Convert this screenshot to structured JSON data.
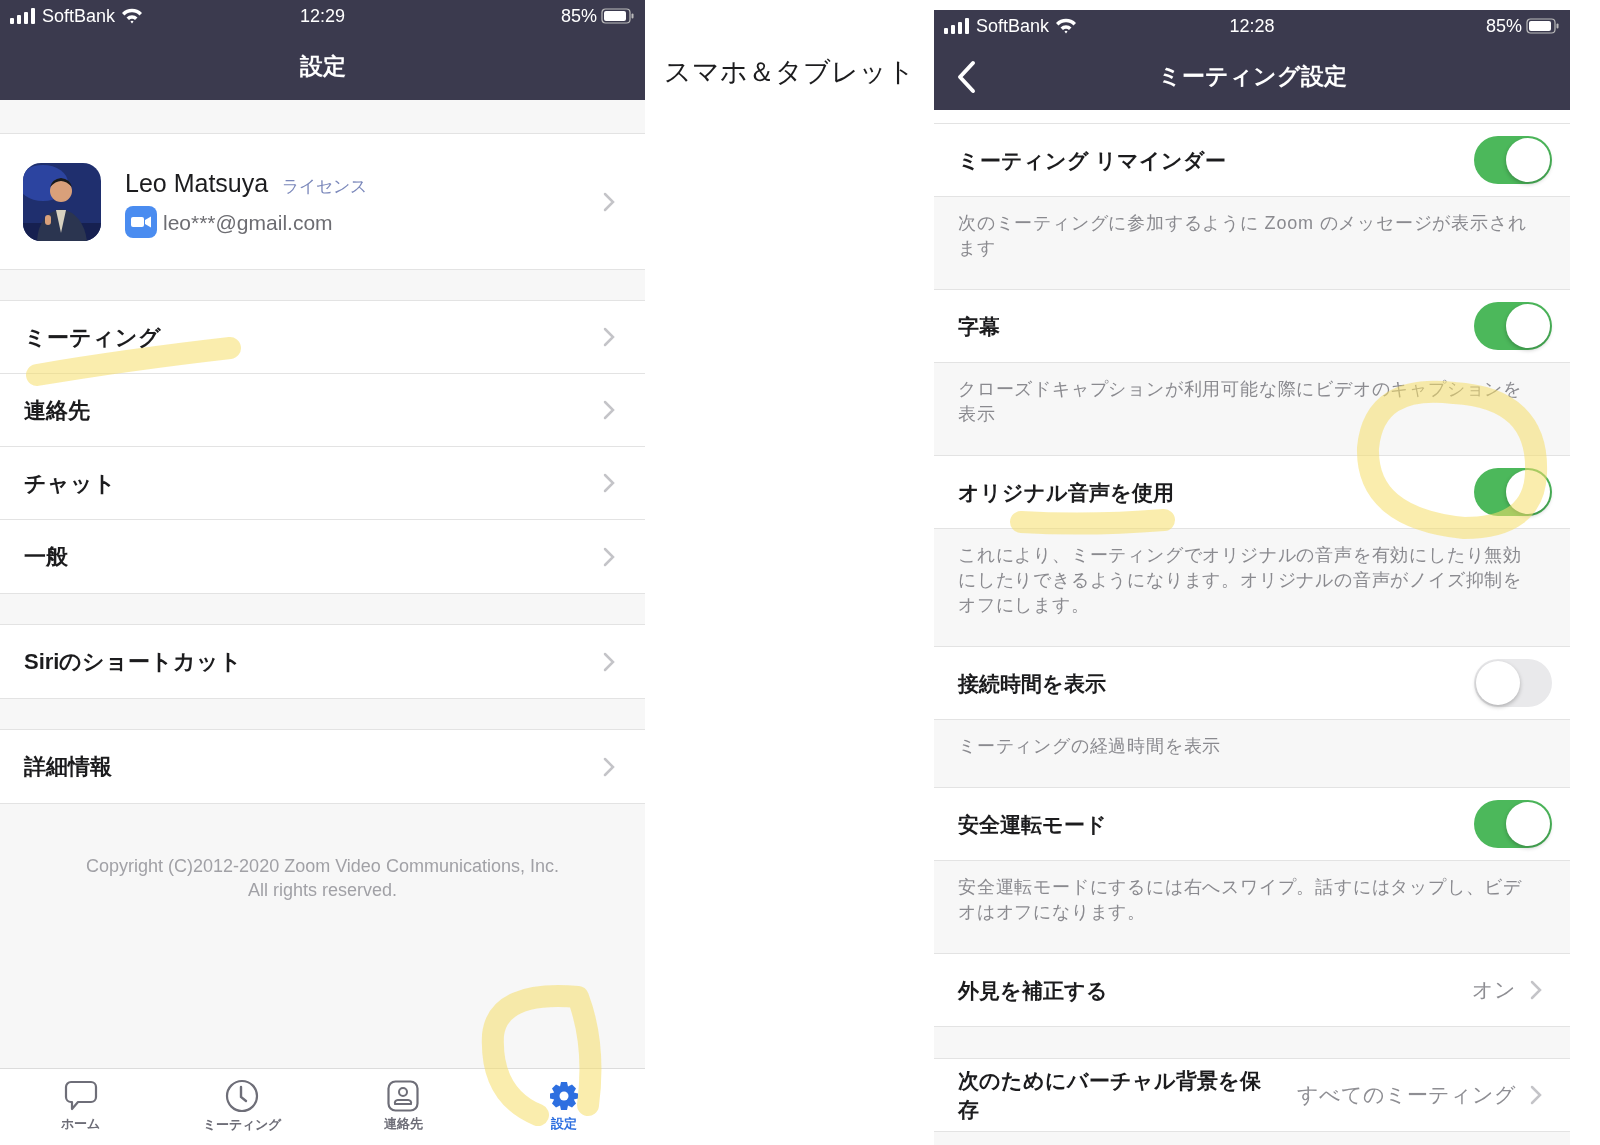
{
  "left_screen": {
    "status_bar": {
      "carrier": "SoftBank",
      "time": "12:29",
      "battery": "85%"
    },
    "title": "設定",
    "profile": {
      "name": "Leo Matsuya",
      "badge": "ライセンス",
      "email": "leo***@gmail.com"
    },
    "groups": [
      [
        "ミーティング",
        "連絡先",
        "チャット",
        "一般"
      ],
      [
        "Siriのショートカット"
      ],
      [
        "詳細情報"
      ]
    ],
    "copyright": [
      "Copyright (C)2012-2020 Zoom Video Communications, Inc.",
      "All rights reserved."
    ],
    "tab_bar": [
      {
        "label": "ホーム",
        "selected": false
      },
      {
        "label": "ミーティング",
        "selected": false
      },
      {
        "label": "連絡先",
        "selected": false
      },
      {
        "label": "設定",
        "selected": true
      }
    ]
  },
  "caption": "スマホ＆タブレット",
  "right_screen": {
    "status_bar": {
      "carrier": "SoftBank",
      "time": "12:28",
      "battery": "85%"
    },
    "title": "ミーティング設定",
    "sections": [
      [
        {
          "kind": "toggle",
          "label": "ミーティング リマインダー",
          "on": true,
          "description": "次のミーティングに参加するように Zoom のメッセージが表示されます"
        },
        {
          "kind": "toggle",
          "label": "字幕",
          "on": true,
          "description": "クローズドキャプションが利用可能な際にビデオのキャプションを表示"
        },
        {
          "kind": "toggle",
          "label": "オリジナル音声を使用",
          "on": true,
          "description": "これにより、ミーティングでオリジナルの音声を有効にしたり無効にしたりできるようになります。オリジナルの音声がノイズ抑制をオフにします。"
        },
        {
          "kind": "toggle",
          "label": "接続時間を表示",
          "on": false,
          "description": "ミーティングの経過時間を表示"
        },
        {
          "kind": "toggle",
          "label": "安全運転モード",
          "on": true,
          "description": "安全運転モードにするには右へスワイプ。話すにはタップし、ビデオはオフになります。"
        },
        {
          "kind": "value",
          "label": "外見を補正する",
          "value": "オン"
        }
      ],
      [
        {
          "kind": "value",
          "label": "次のためにバーチャル背景を保存",
          "value": "すべてのミーティング"
        }
      ]
    ]
  }
}
